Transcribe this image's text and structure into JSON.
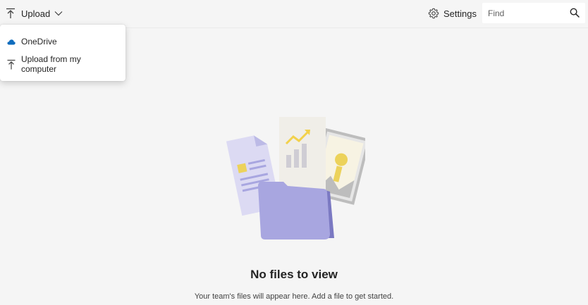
{
  "toolbar": {
    "upload_label": "Upload",
    "upload_icon": "arrow-up-to-line-icon",
    "upload_chevron": "chevron-down-icon",
    "settings_label": "Settings",
    "settings_icon": "gear-icon",
    "search": {
      "placeholder": "Find",
      "value": "",
      "icon": "search-icon"
    }
  },
  "upload_menu": {
    "items": [
      {
        "label": "OneDrive",
        "icon": "onedrive-cloud-icon",
        "icon_color": "#0f6cbd"
      },
      {
        "label": "Upload from my computer",
        "icon": "arrow-up-to-line-icon"
      }
    ]
  },
  "empty_state": {
    "title": "No files to view",
    "subtitle": "Your team's files will appear here. Add a file to get started.",
    "illustration": "folder-with-documents-illustration"
  },
  "colors": {
    "background": "#f5f5f5",
    "accent_purple": "#a8a6e0",
    "folder_dark": "#7b79c2",
    "chart_yellow": "#f2d14b"
  }
}
